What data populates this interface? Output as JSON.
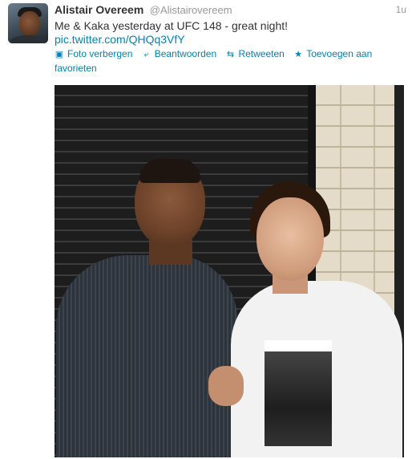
{
  "tweet": {
    "name": "Alistair Overeem",
    "handle": "@Alistairovereem",
    "time": "1u",
    "text": "Me & Kaka yesterday at UFC 148 - great night!",
    "link": "pic.twitter.com/QHQq3VfY"
  },
  "actions": [
    {
      "label": "Foto verbergen",
      "icon": "photo-icon"
    },
    {
      "label": "Beantwoorden",
      "icon": "reply-icon"
    },
    {
      "label": "Retweeten",
      "icon": "retweet-icon"
    },
    {
      "label": "Toevoegen aan",
      "icon": "star-icon"
    }
  ],
  "actions_wrap": "favorieten",
  "colors": {
    "link": "#0084b4",
    "text": "#333333",
    "muted": "#999999"
  }
}
